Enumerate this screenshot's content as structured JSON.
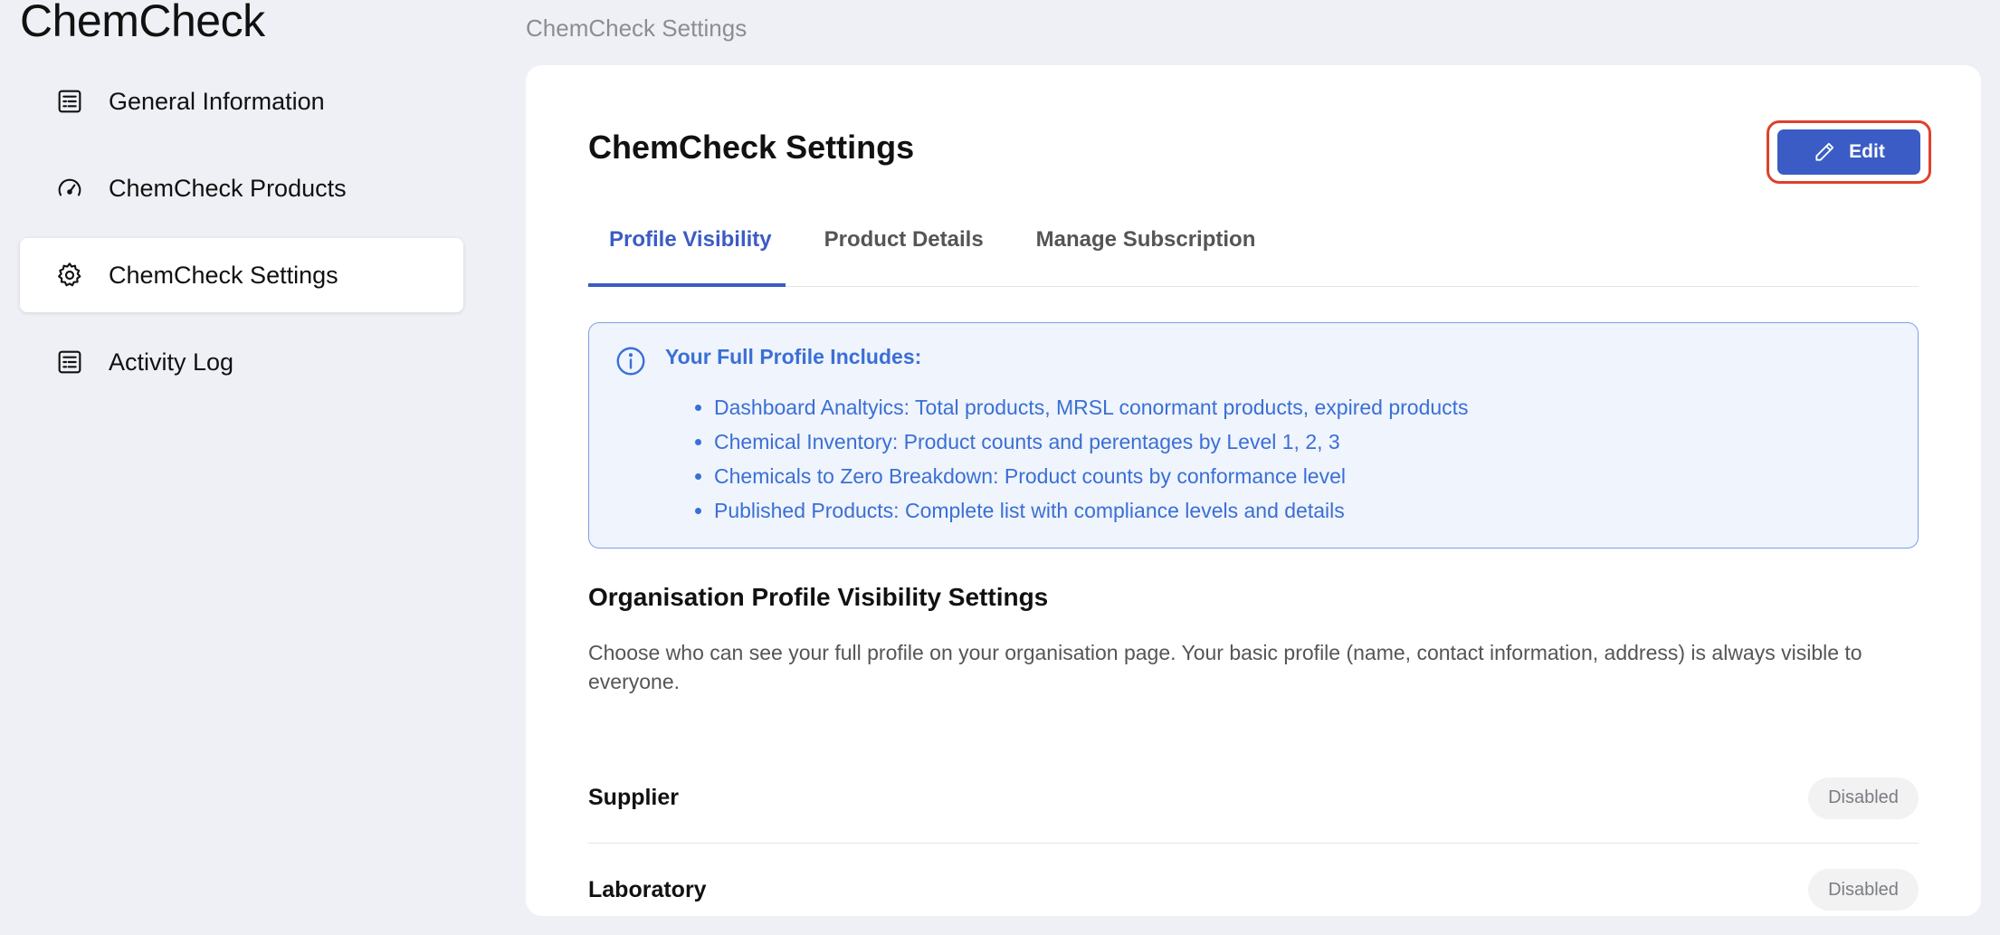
{
  "app": {
    "title": "ChemCheck"
  },
  "sidebar": {
    "items": [
      {
        "label": "General Information",
        "icon": "document-list-icon",
        "active": false
      },
      {
        "label": "ChemCheck Products",
        "icon": "gauge-icon",
        "active": false
      },
      {
        "label": "ChemCheck Settings",
        "icon": "gear-icon",
        "active": true
      },
      {
        "label": "Activity Log",
        "icon": "document-list-icon",
        "active": false
      }
    ]
  },
  "header": {
    "breadcrumb": "ChemCheck Settings"
  },
  "main": {
    "title": "ChemCheck Settings",
    "edit_label": "Edit",
    "edit_icon": "pencil-icon",
    "tabs": [
      {
        "label": "Profile Visibility",
        "active": true
      },
      {
        "label": "Product Details",
        "active": false
      },
      {
        "label": "Manage Subscription",
        "active": false
      }
    ],
    "info": {
      "icon": "info-icon",
      "heading": "Your Full Profile Includes:",
      "items": [
        "Dashboard Analtyics: Total products, MRSL conormant products, expired products",
        "Chemical Inventory: Product counts and perentages by Level 1, 2, 3",
        "Chemicals to Zero Breakdown: Product counts by conformance level",
        "Published Products: Complete list with compliance levels and details"
      ]
    },
    "visibility": {
      "title": "Organisation Profile Visibility Settings",
      "description": "Choose who can see your full profile on your organisation page. Your basic profile (name, contact information, address) is always visible to everyone.",
      "rows": [
        {
          "label": "Supplier",
          "status": "Disabled"
        },
        {
          "label": "Laboratory",
          "status": "Disabled"
        }
      ]
    }
  },
  "colors": {
    "accent": "#3b5cc4",
    "highlight_outline": "#e0402b",
    "info_text": "#3b6fd4",
    "info_bg": "#eff4fd",
    "page_bg": "#eef0f5"
  }
}
